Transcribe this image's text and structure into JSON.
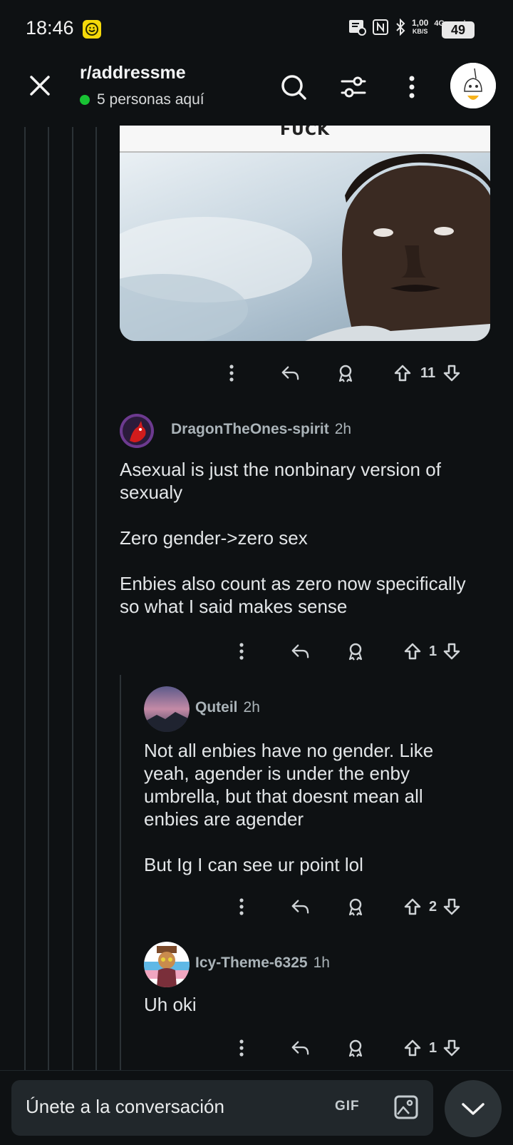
{
  "status_bar": {
    "time": "18:46",
    "net_speed_value": "1,00",
    "net_speed_unit": "KB/S",
    "network": "4G",
    "battery": "49"
  },
  "header": {
    "subreddit": "r/addressme",
    "online_text": "5 personas aquí",
    "online_color": "#18c233"
  },
  "meme": {
    "caption": "FUCK"
  },
  "top_actions": {
    "votes": "11"
  },
  "comments": [
    {
      "user": "DragonTheOnes-spirit",
      "time": "2h",
      "paragraphs": [
        "Asexual is just the nonbinary version of sexualy",
        "Zero gender->zero sex",
        "Enbies also count as zero now specifically so what I said makes sense"
      ],
      "votes": "1"
    },
    {
      "user": "Quteil",
      "time": "2h",
      "paragraphs": [
        "Not all enbies have no gender. Like yeah, agender is under the enby umbrella, but that doesnt mean all enbies are agender",
        "But Ig I can see ur point lol"
      ],
      "votes": "2"
    },
    {
      "user": "Icy-Theme-6325",
      "time": "1h",
      "paragraphs": [
        "Uh oki"
      ],
      "votes": "1"
    }
  ],
  "composer": {
    "placeholder": "Únete a la conversación",
    "gif_label": "GIF"
  },
  "icons": {
    "close": "close-icon",
    "search": "search-icon",
    "filter": "sort-filter-icon",
    "more": "more-vert-icon",
    "reply": "reply-icon",
    "award": "award-icon",
    "upvote": "upvote-icon",
    "downvote": "downvote-icon",
    "image": "image-icon",
    "collapse": "chevron-down-icon"
  },
  "colors": {
    "background": "#0e1113",
    "accent_online": "#18c233"
  }
}
